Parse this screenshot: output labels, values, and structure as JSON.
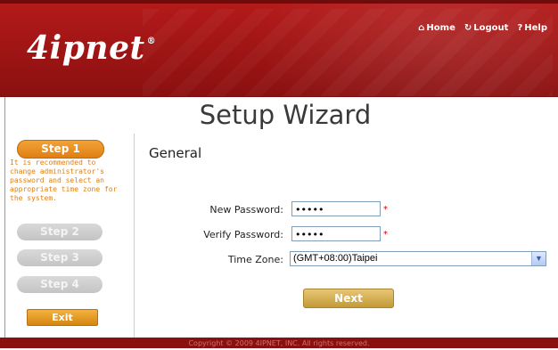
{
  "header": {
    "logo_text": "4ipnet",
    "logo_mark": "®",
    "links": [
      {
        "icon": "home-icon",
        "glyph": "⌂",
        "label": "Home"
      },
      {
        "icon": "logout-icon",
        "glyph": "↻",
        "label": "Logout"
      },
      {
        "icon": "help-icon",
        "glyph": "?",
        "label": "Help"
      }
    ]
  },
  "page": {
    "title": "Setup Wizard"
  },
  "sidebar": {
    "steps": [
      "Step 1",
      "Step 2",
      "Step 3",
      "Step 4"
    ],
    "active_step": 1,
    "note": "It is recommended to change administrator's password and select an appropriate time zone for the system.",
    "exit_label": "Exit"
  },
  "form": {
    "section_title": "General",
    "new_password_label": "New Password:",
    "new_password_value": "•••••",
    "verify_password_label": "Verify Password:",
    "verify_password_value": "•••••",
    "required_mark": "*",
    "time_zone_label": "Time Zone:",
    "time_zone_value": "(GMT+08:00)Taipei",
    "next_label": "Next"
  },
  "footer": {
    "copyright": "Copyright © 2009 4IPNET, INC. All rights reserved."
  },
  "colors": {
    "brand_red": "#9c1414",
    "accent_orange": "#e07f12",
    "button_gold": "#c49a35"
  }
}
